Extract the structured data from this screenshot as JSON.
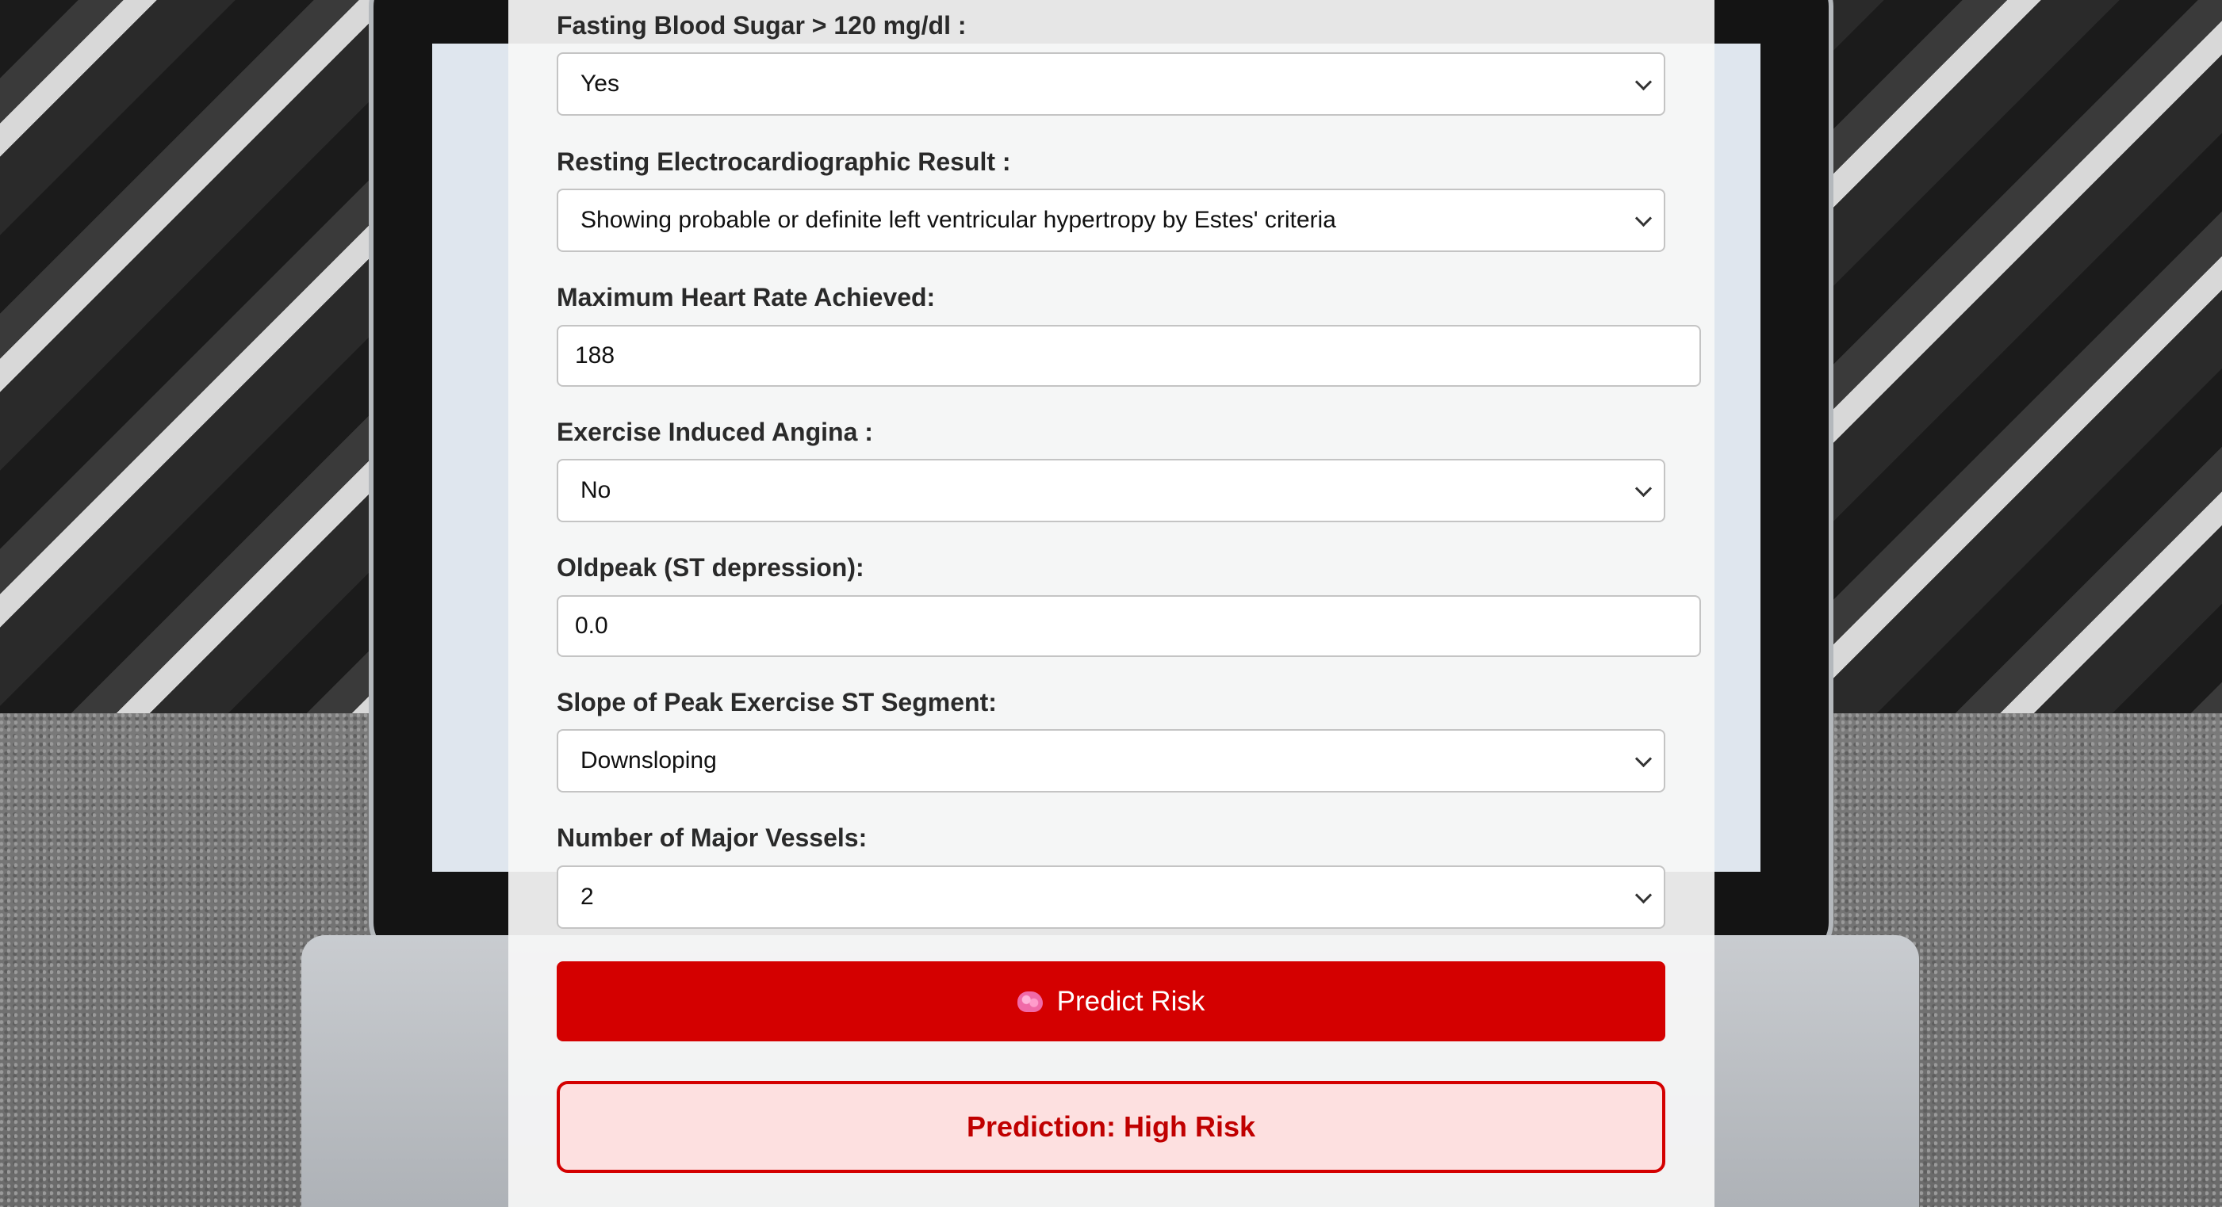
{
  "form": {
    "fasting_blood_sugar": {
      "label": "Fasting Blood Sugar > 120 mg/dl :",
      "value": "Yes"
    },
    "resting_ecg": {
      "label": "Resting Electrocardiographic Result :",
      "value": "Showing probable or definite left ventricular hypertropy by Estes' criteria"
    },
    "max_heart_rate": {
      "label": "Maximum Heart Rate Achieved:",
      "value": "188"
    },
    "exercise_angina": {
      "label": "Exercise Induced Angina :",
      "value": "No"
    },
    "oldpeak": {
      "label": "Oldpeak (ST depression):",
      "value": "0.0"
    },
    "slope": {
      "label": "Slope of Peak Exercise ST Segment:",
      "value": "Downsloping"
    },
    "major_vessels": {
      "label": "Number of Major Vessels:",
      "value": "2"
    }
  },
  "predict_button": {
    "label": "Predict Risk",
    "icon": "brain-icon"
  },
  "result": {
    "text": "Prediction: High Risk"
  },
  "colors": {
    "accent": "#d40000",
    "result_bg": "#fde0e0",
    "result_text": "#c00000"
  }
}
